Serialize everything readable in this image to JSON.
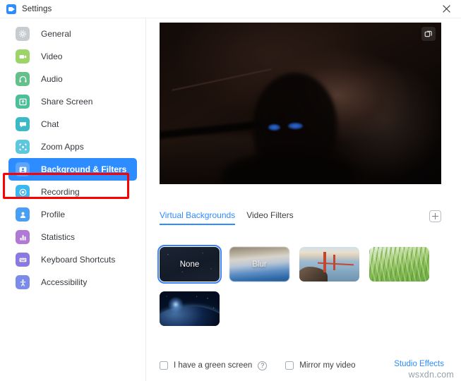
{
  "window": {
    "title": "Settings",
    "app_icon": "zoom-camera-icon",
    "close_icon": "close-icon"
  },
  "sidebar": {
    "items": [
      {
        "label": "General",
        "icon": "gear-icon",
        "color": "#c7ccd1",
        "active": false
      },
      {
        "label": "Video",
        "icon": "video-icon",
        "color": "#9ed36a",
        "active": false
      },
      {
        "label": "Audio",
        "icon": "headphones-icon",
        "color": "#63c08a",
        "active": false
      },
      {
        "label": "Share Screen",
        "icon": "upload-icon",
        "color": "#4cbf9a",
        "active": false
      },
      {
        "label": "Chat",
        "icon": "chat-icon",
        "color": "#3cb9c4",
        "active": false
      },
      {
        "label": "Zoom Apps",
        "icon": "apps-icon",
        "color": "#5ec7dd",
        "active": false
      },
      {
        "label": "Background & Filters",
        "icon": "person-frame-icon",
        "color": "#ffffff",
        "active": true
      },
      {
        "label": "Recording",
        "icon": "record-icon",
        "color": "#3bb6ef",
        "active": false
      },
      {
        "label": "Profile",
        "icon": "person-icon",
        "color": "#4a9ff5",
        "active": false
      },
      {
        "label": "Statistics",
        "icon": "bar-chart-icon",
        "color": "#b07ad4",
        "active": false
      },
      {
        "label": "Keyboard Shortcuts",
        "icon": "keyboard-icon",
        "color": "#8a7ae0",
        "active": false
      },
      {
        "label": "Accessibility",
        "icon": "accessibility-icon",
        "color": "#7a8ce8",
        "active": false
      }
    ],
    "highlight_color": "#2d8cff",
    "annotation_color": "#ff0000"
  },
  "preview": {
    "popout_icon": "popout-windows-icon",
    "description": "dark webcam self-view"
  },
  "tabs": [
    {
      "label": "Virtual Backgrounds",
      "active": true
    },
    {
      "label": "Video Filters",
      "active": false
    }
  ],
  "add_background": {
    "icon": "plus-icon",
    "label": "+"
  },
  "backgrounds": [
    {
      "label": "None",
      "style": "bg-none",
      "selected": true
    },
    {
      "label": "Blur",
      "style": "bg-blur",
      "selected": false
    },
    {
      "label": "",
      "style": "bg-bridge",
      "selected": false
    },
    {
      "label": "",
      "style": "bg-grass",
      "selected": false
    },
    {
      "label": "",
      "style": "bg-earth",
      "selected": false
    }
  ],
  "options": {
    "green_screen_label": "I have a green screen",
    "green_screen_checked": false,
    "help_icon": "question-mark-icon",
    "help_glyph": "?",
    "mirror_label": "Mirror my video",
    "mirror_checked": false,
    "studio_effects_label": "Studio Effects",
    "link_color": "#2d8cff"
  },
  "watermark": {
    "text": "wsxdn.com"
  }
}
